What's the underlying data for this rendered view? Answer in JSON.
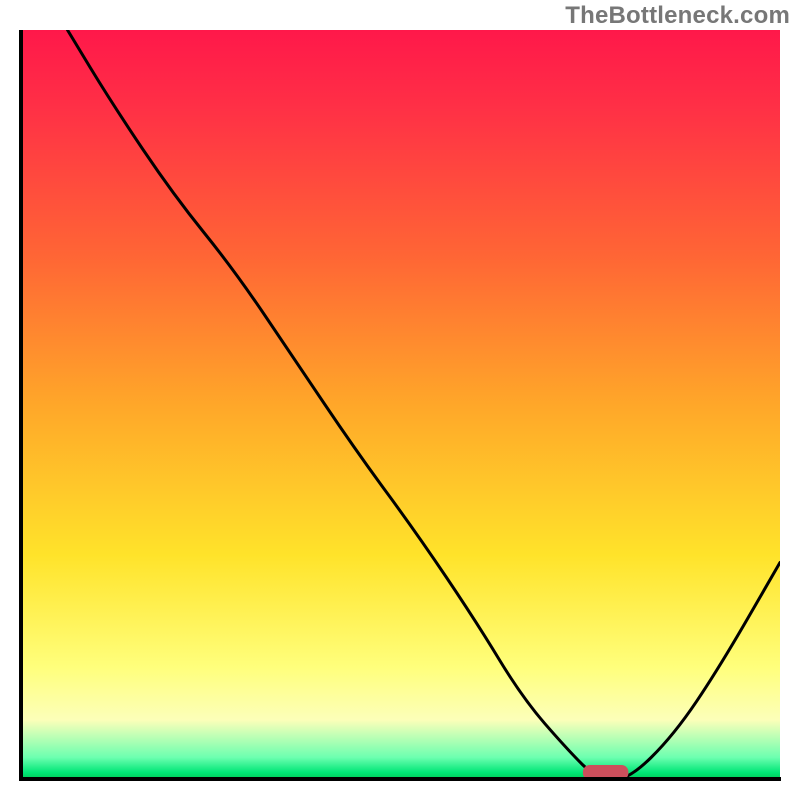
{
  "watermark": "TheBottleneck.com",
  "chart_data": {
    "type": "line",
    "title": "",
    "xlabel": "",
    "ylabel": "",
    "xlim": [
      0,
      100
    ],
    "ylim": [
      0,
      100
    ],
    "grid": false,
    "legend": false,
    "background_gradient": {
      "direction": "vertical",
      "stops": [
        {
          "pos": 0,
          "color": "#ff184a"
        },
        {
          "pos": 10,
          "color": "#ff2f46"
        },
        {
          "pos": 30,
          "color": "#ff6535"
        },
        {
          "pos": 50,
          "color": "#ffa729"
        },
        {
          "pos": 70,
          "color": "#ffe32a"
        },
        {
          "pos": 85,
          "color": "#ffff7c"
        },
        {
          "pos": 92,
          "color": "#fcffb9"
        },
        {
          "pos": 97,
          "color": "#6cffb0"
        },
        {
          "pos": 99,
          "color": "#00e676"
        },
        {
          "pos": 100,
          "color": "#00c853"
        }
      ]
    },
    "series": [
      {
        "name": "bottleneck-curve",
        "x": [
          6,
          12,
          20,
          28,
          36,
          44,
          52,
          60,
          66,
          72,
          76,
          80,
          86,
          92,
          100
        ],
        "y": [
          100,
          90,
          78,
          68,
          56,
          44,
          33,
          21,
          11,
          4,
          0,
          0,
          6,
          15,
          29
        ]
      }
    ],
    "marker": {
      "name": "optimal-point",
      "shape": "rounded-rect",
      "x": 77,
      "y": 1,
      "color": "#cc4f5c",
      "width_pct": 6,
      "height_pct": 2
    }
  }
}
